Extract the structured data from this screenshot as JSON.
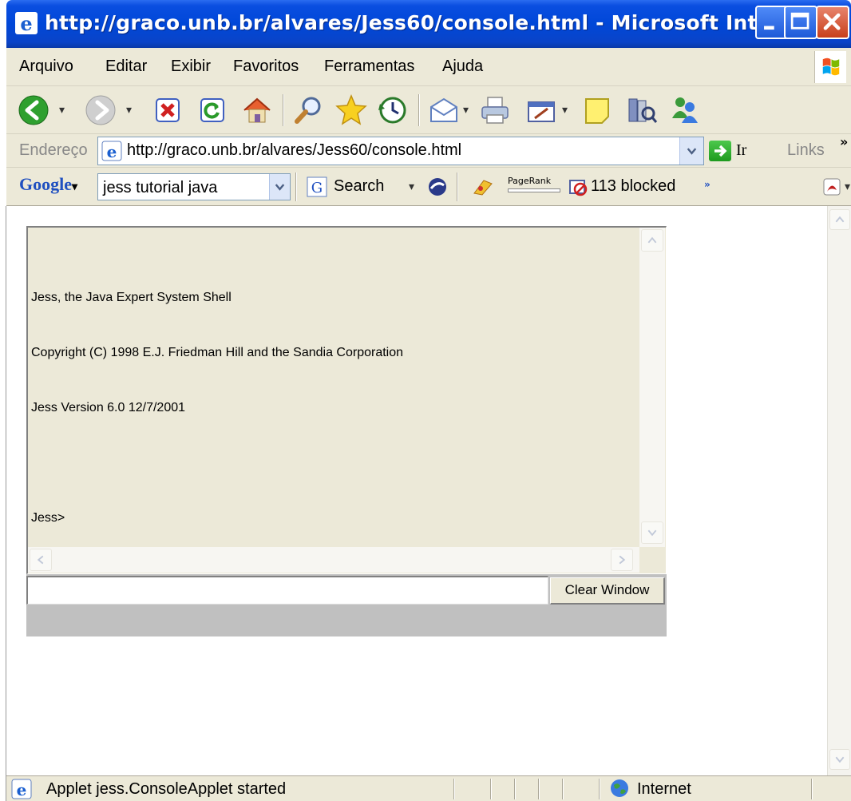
{
  "window": {
    "title": "http://graco.unb.br/alvares/Jess60/console.html - Microsoft Internet ..."
  },
  "menu": {
    "items": [
      "Arquivo",
      "Editar",
      "Exibir",
      "Favoritos",
      "Ferramentas",
      "Ajuda"
    ]
  },
  "toolbar": {
    "icons": [
      "back-icon",
      "forward-icon",
      "stop-icon",
      "refresh-icon",
      "home-icon",
      "search-icon",
      "favorites-icon",
      "history-icon",
      "mail-icon",
      "print-icon",
      "edit-icon",
      "discuss-icon",
      "research-icon",
      "messenger-icon"
    ]
  },
  "address": {
    "label": "Endereço",
    "url": "http://graco.unb.br/alvares/Jess60/console.html",
    "go_label": "Ir",
    "links_label": "Links"
  },
  "google": {
    "logo": "Google",
    "query": "jess tutorial java",
    "search_label": "Search",
    "pagerank_label": "PageRank",
    "blocked_label": "113 blocked"
  },
  "console": {
    "lines": [
      "Jess, the Java Expert System Shell",
      "Copyright (C) 1998 E.J. Friedman Hill and the Sandia Corporation",
      "Jess Version 6.0 12/7/2001",
      "",
      "Jess>"
    ],
    "input_value": "",
    "clear_button": "Clear Window"
  },
  "status": {
    "text": "Applet jess.ConsoleApplet started",
    "zone": "Internet"
  },
  "colors": {
    "titlebar": "#0047d8",
    "chrome": "#ece9d8",
    "applet_gray": "#c0c0c0",
    "close_button": "#c8401c"
  }
}
